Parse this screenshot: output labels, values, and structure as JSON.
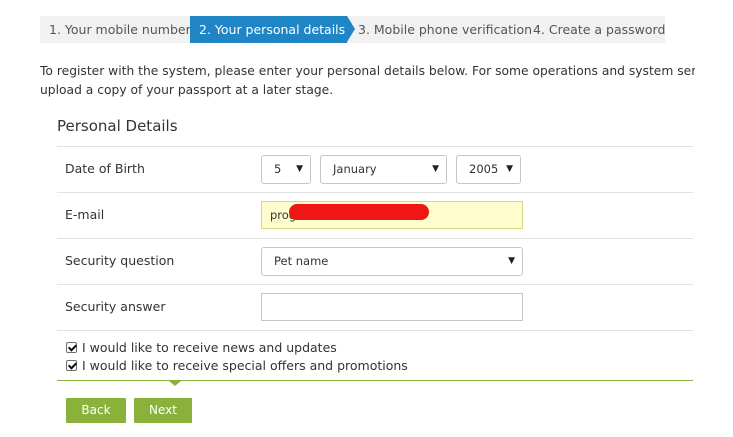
{
  "steps": [
    {
      "label": "1. Your mobile number",
      "active": false
    },
    {
      "label": "2. Your personal details",
      "active": true
    },
    {
      "label": "3. Mobile phone verification",
      "active": false
    },
    {
      "label": "4. Create a password",
      "active": false
    }
  ],
  "intro": {
    "line1": "To register with the system, please enter your personal details below. For some operations and system services y",
    "line2": "upload a copy of your passport at a later stage."
  },
  "section": {
    "title": "Personal Details"
  },
  "form": {
    "dob": {
      "label": "Date of Birth",
      "day": "5",
      "month": "January",
      "year": "2005"
    },
    "email": {
      "label": "E-mail",
      "value": "prog"
    },
    "security_question": {
      "label": "Security question",
      "value": "Pet name"
    },
    "security_answer": {
      "label": "Security answer",
      "value": ""
    }
  },
  "checkboxes": [
    {
      "label": "I would like to receive news and updates",
      "checked": true
    },
    {
      "label": "I would like to receive special offers and promotions",
      "checked": true
    }
  ],
  "buttons": {
    "back": "Back",
    "next": "Next"
  },
  "colors": {
    "active_step": "#1f85c4",
    "accent_green": "#8ab23a",
    "autofill_yellow": "#fefdcb",
    "redaction": "#f01616"
  },
  "icons": {
    "select_arrow": "dropdown-arrow-icon",
    "checkbox": "checkmark-icon"
  }
}
